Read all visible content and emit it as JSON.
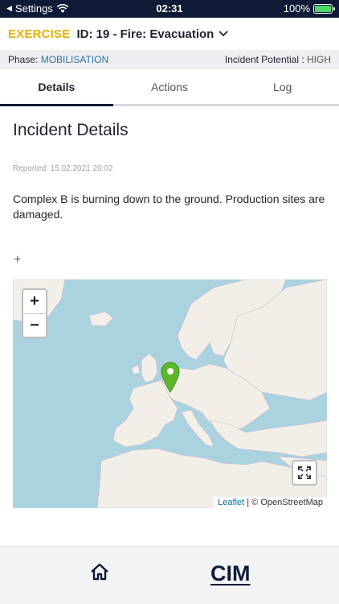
{
  "status_bar": {
    "back_label": "Settings",
    "time": "02:31",
    "battery": "100%",
    "icons": [
      "back-arrow-icon",
      "wifi-icon",
      "battery-icon"
    ]
  },
  "header": {
    "mode": "EXERCISE",
    "title": "ID: 19 - Fire: Evacuation",
    "mode_color": "#e8b100"
  },
  "phase_bar": {
    "phase_label": "Phase:",
    "phase_value": "MOBILISATION",
    "potential_label": "Incident Potential :",
    "potential_value": "HIGH"
  },
  "tabs": [
    {
      "label": "Details",
      "active": true
    },
    {
      "label": "Actions",
      "active": false
    },
    {
      "label": "Log",
      "active": false
    }
  ],
  "details": {
    "heading": "Incident Details",
    "reported": "Reported: 15.02.2021 20:02",
    "description": "Complex B is burning down to the ground. Production sites are damaged.",
    "add_symbol": "+"
  },
  "map": {
    "zoom_in": "+",
    "zoom_out": "−",
    "attribution_leaflet": "Leaflet",
    "attribution_rest": "| © OpenStreetMap",
    "water_color": "#aad3df",
    "land_color": "#f2efe9",
    "marker_color": "#5cb82a"
  },
  "bottom_bar": {
    "logo": "CIM",
    "icons": [
      "home-icon"
    ]
  }
}
